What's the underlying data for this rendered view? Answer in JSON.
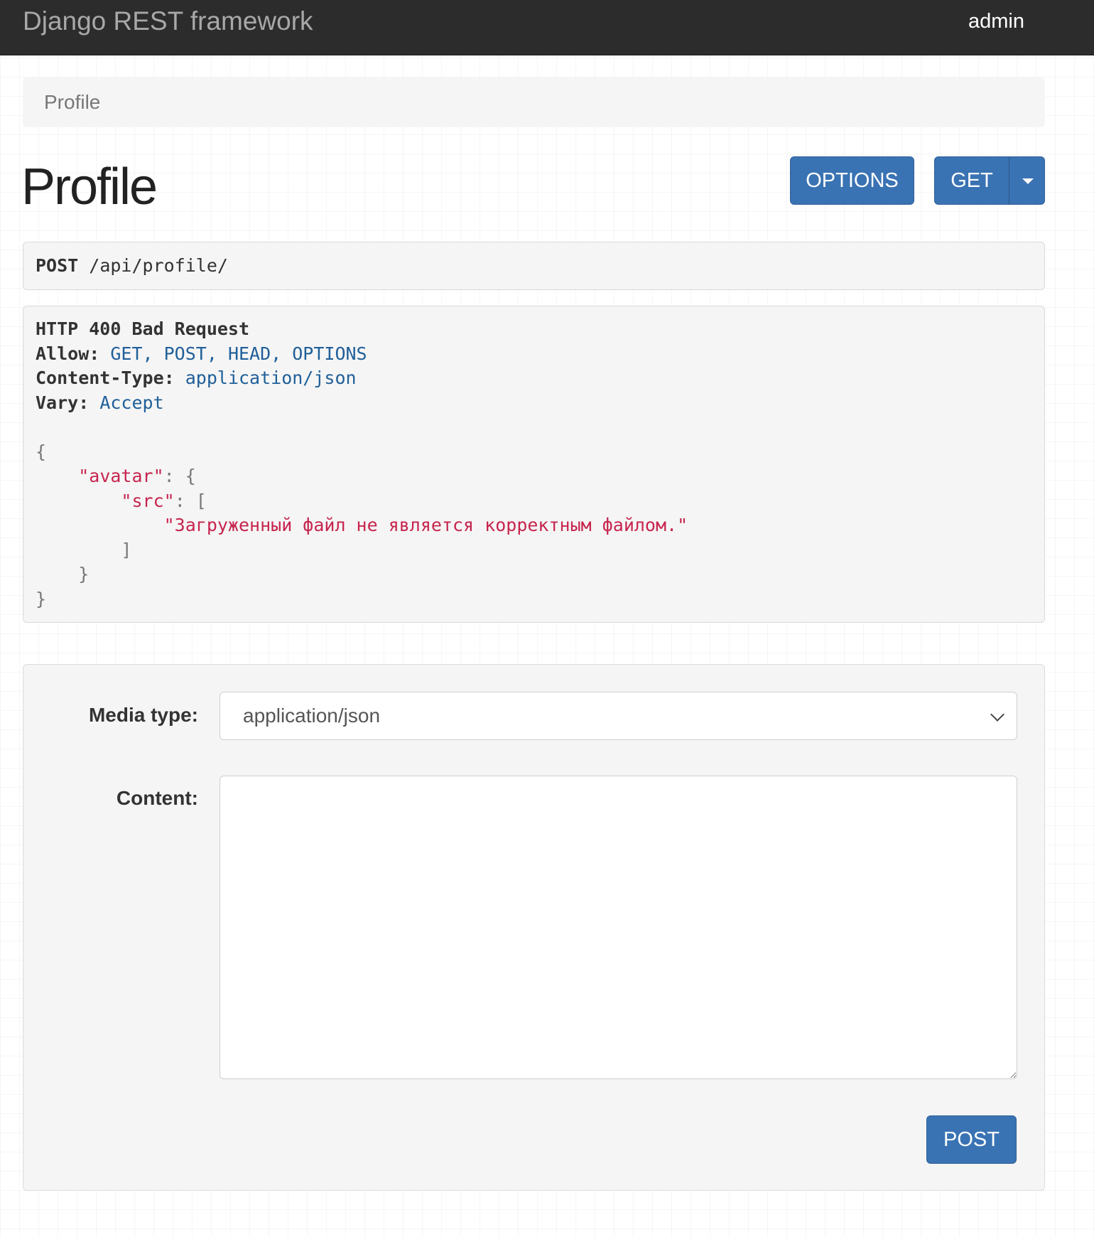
{
  "navbar": {
    "brand": "Django REST framework",
    "user": "admin"
  },
  "breadcrumb": {
    "current": "Profile"
  },
  "page": {
    "title": "Profile"
  },
  "buttons": {
    "options": "OPTIONS",
    "get": "GET",
    "post": "POST"
  },
  "request": {
    "method": "POST",
    "url": "/api/profile/"
  },
  "response": {
    "status": "HTTP 400 Bad Request",
    "headers": [
      {
        "key": "Allow:",
        "value": "GET, POST, HEAD, OPTIONS"
      },
      {
        "key": "Content-Type:",
        "value": "application/json"
      },
      {
        "key": "Vary:",
        "value": "Accept"
      }
    ],
    "body": {
      "open": "{",
      "avatar_key": "\"avatar\"",
      "avatar_open": ": {",
      "src_key": "\"src\"",
      "src_open": ": [",
      "error_message": "\"Загруженный файл не является корректным файлом.\"",
      "src_close": "]",
      "avatar_close": "}",
      "close": "}"
    }
  },
  "form": {
    "media_type_label": "Media type:",
    "media_type_value": "application/json",
    "content_label": "Content:",
    "content_value": ""
  },
  "colors": {
    "navbar_bg": "#2c2c2c",
    "button_primary": "#3a73b3",
    "header_value": "#1f5f99",
    "json_string": "#c7254e"
  }
}
